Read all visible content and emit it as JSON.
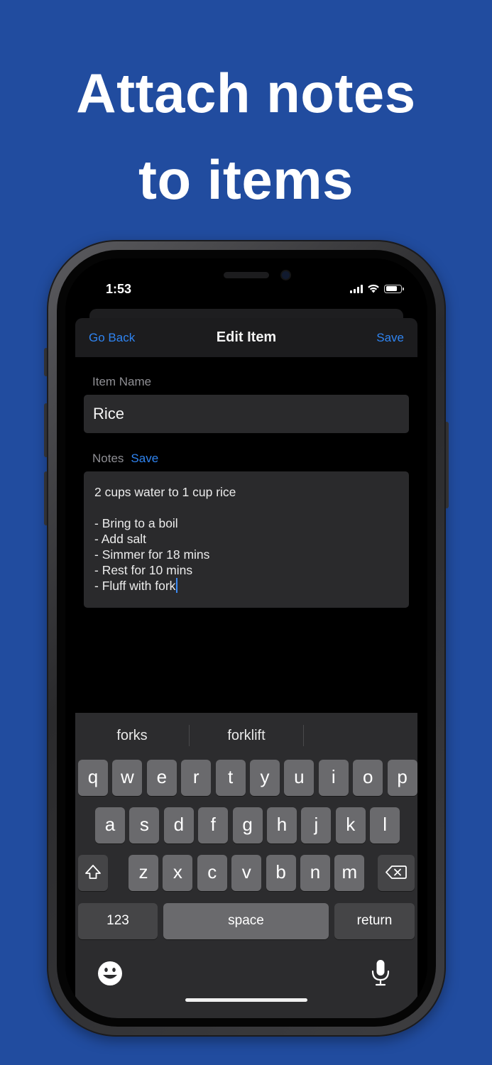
{
  "headline": {
    "line1": "Attach notes",
    "line2": "to items"
  },
  "status_bar": {
    "time": "1:53"
  },
  "navbar": {
    "back_label": "Go Back",
    "title": "Edit Item",
    "save_label": "Save"
  },
  "item_name": {
    "label": "Item Name",
    "value": "Rice"
  },
  "notes": {
    "label": "Notes",
    "save_label": "Save",
    "lines": [
      "2 cups water to 1 cup rice",
      "",
      "- Bring to a boil",
      "- Add salt",
      "- Simmer for 18 mins",
      "- Rest for 10 mins",
      "- Fluff with fork"
    ]
  },
  "keyboard": {
    "suggestions": [
      "forks",
      "forklift",
      ""
    ],
    "row1": [
      "q",
      "w",
      "e",
      "r",
      "t",
      "y",
      "u",
      "i",
      "o",
      "p"
    ],
    "row2": [
      "a",
      "s",
      "d",
      "f",
      "g",
      "h",
      "j",
      "k",
      "l"
    ],
    "row3": [
      "z",
      "x",
      "c",
      "v",
      "b",
      "n",
      "m"
    ],
    "numbers_label": "123",
    "space_label": "space",
    "return_label": "return"
  },
  "colors": {
    "background": "#214c9f",
    "accent": "#2f84f1",
    "field": "#2a2a2c",
    "key": "#6a6a6d",
    "key_dark": "#454547"
  }
}
